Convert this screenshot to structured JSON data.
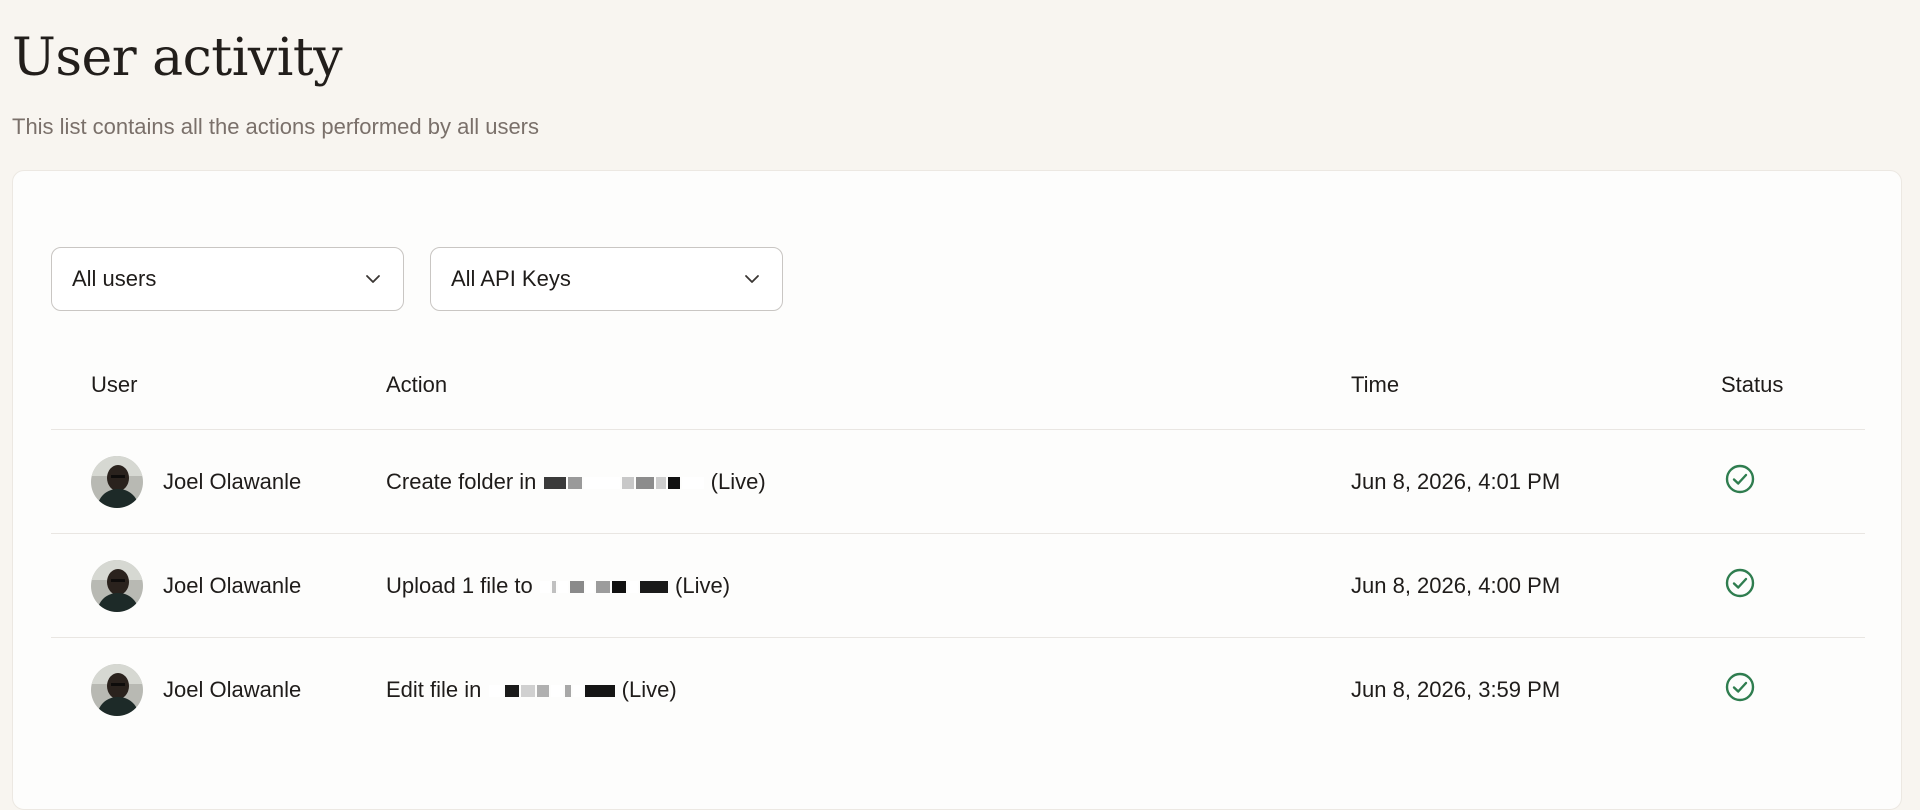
{
  "page": {
    "title": "User activity",
    "subtitle": "This list contains all the actions performed by all users"
  },
  "filters": {
    "users": {
      "selected": "All users",
      "icon": "chevron-down-icon"
    },
    "api_keys": {
      "selected": "All API Keys",
      "icon": "chevron-down-icon"
    }
  },
  "table": {
    "headers": {
      "user": "User",
      "action": "Action",
      "time": "Time",
      "status": "Status"
    },
    "rows": [
      {
        "user": "Joel Olawanle",
        "action_prefix": "Create folder in",
        "action_suffix": "(Live)",
        "time": "Jun 8, 2026, 4:01 PM",
        "status_icon": "check-circle-icon"
      },
      {
        "user": "Joel Olawanle",
        "action_prefix": "Upload 1 file to",
        "action_suffix": "(Live)",
        "time": "Jun 8, 2026, 4:00 PM",
        "status_icon": "check-circle-icon"
      },
      {
        "user": "Joel Olawanle",
        "action_prefix": "Edit file in",
        "action_suffix": "(Live)",
        "time": "Jun 8, 2026, 3:59 PM",
        "status_icon": "check-circle-icon"
      }
    ]
  },
  "colors": {
    "background": "#f8f5f0",
    "card": "#fdfdfc",
    "success": "#2f7d4f",
    "subtitle": "#7a706a"
  }
}
